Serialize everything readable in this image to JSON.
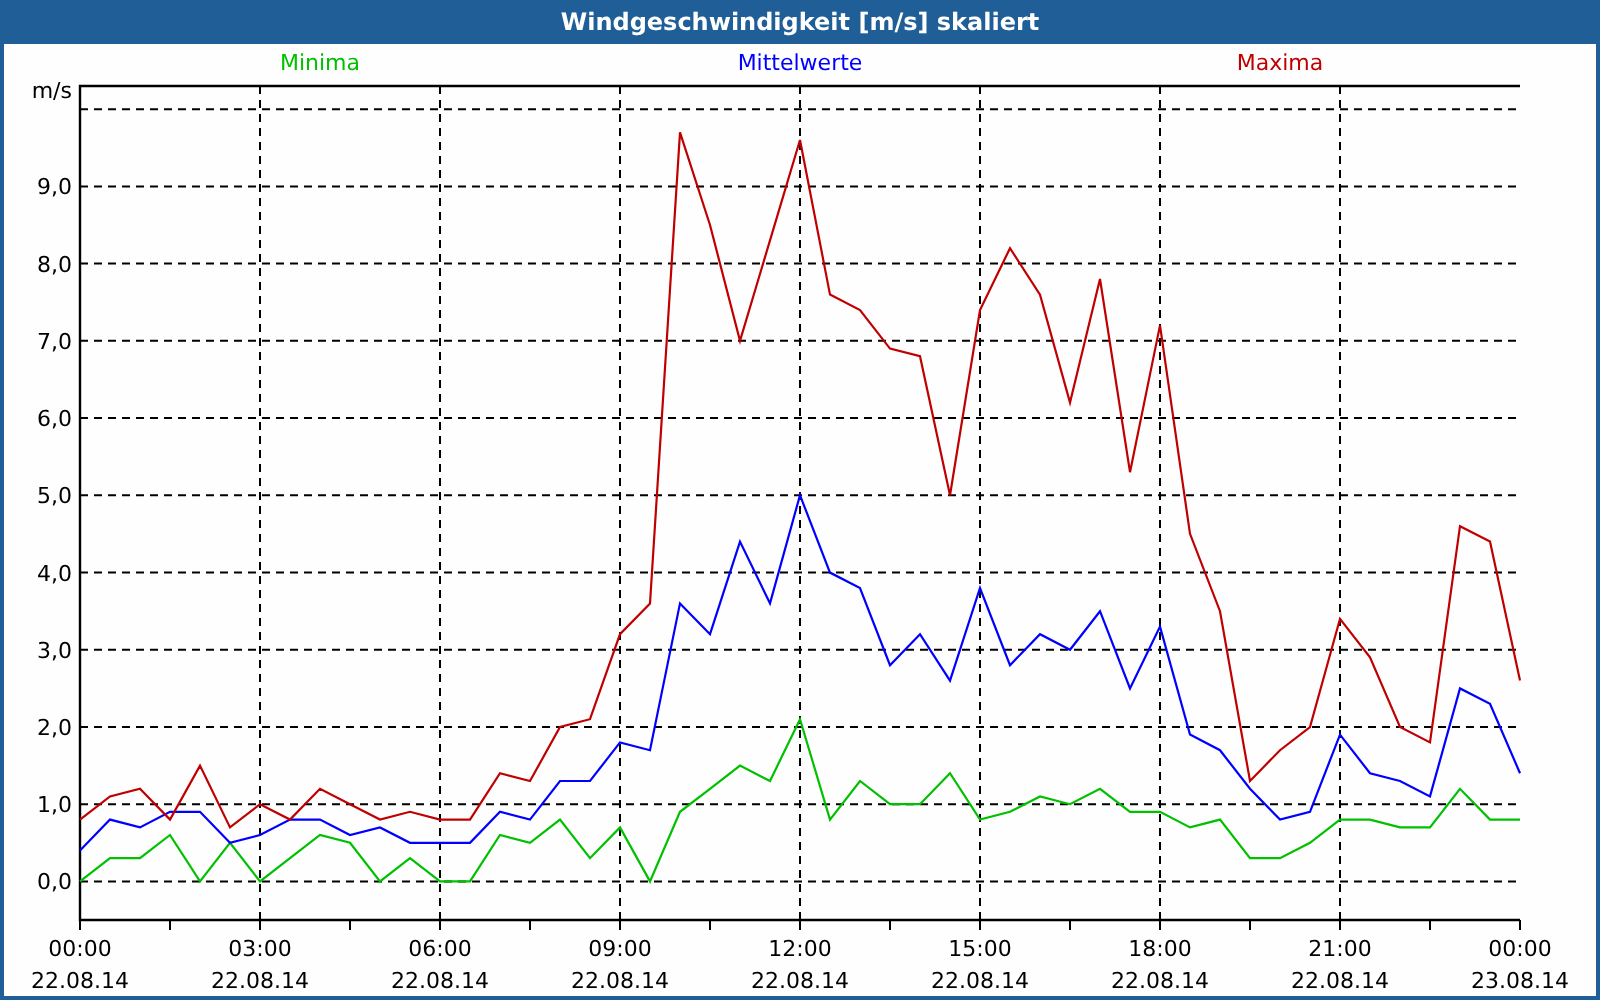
{
  "window": {
    "title": "Windgeschwindigkeit [m/s] skaliert"
  },
  "chart_data": {
    "type": "line",
    "grid": true,
    "ylabel": "m/s",
    "ylim": [
      -0.5,
      10.3
    ],
    "categories": [
      "00:00\n22.08.14",
      null,
      null,
      null,
      null,
      null,
      "03:00\n22.08.14",
      null,
      null,
      null,
      null,
      null,
      "06:00\n22.08.14",
      null,
      null,
      null,
      null,
      null,
      "09:00\n22.08.14",
      null,
      null,
      null,
      null,
      null,
      "12:00\n22.08.14",
      null,
      null,
      null,
      null,
      null,
      "15:00\n22.08.14",
      null,
      null,
      null,
      null,
      null,
      "18:00\n22.08.14",
      null,
      null,
      null,
      null,
      null,
      "21:00\n22.08.14",
      null,
      null,
      null,
      null,
      null,
      "00:00\n23.08.14"
    ],
    "yticks": [
      {
        "value": 0,
        "label": "0,0"
      },
      {
        "value": 1,
        "label": "1,0"
      },
      {
        "value": 2,
        "label": "2,0"
      },
      {
        "value": 3,
        "label": "3,0"
      },
      {
        "value": 4,
        "label": "4,0"
      },
      {
        "value": 5,
        "label": "5,0"
      },
      {
        "value": 6,
        "label": "6,0"
      },
      {
        "value": 7,
        "label": "7,0"
      },
      {
        "value": 8,
        "label": "8,0"
      },
      {
        "value": 9,
        "label": "9,0"
      }
    ],
    "series": [
      {
        "name": "Minima",
        "color": "#00c000",
        "values": [
          0.0,
          0.3,
          0.3,
          0.6,
          0.0,
          0.5,
          0.0,
          0.3,
          0.6,
          0.5,
          0.0,
          0.3,
          0.0,
          0.0,
          0.6,
          0.5,
          0.8,
          0.3,
          0.7,
          0.0,
          0.9,
          1.2,
          1.5,
          1.3,
          2.1,
          0.8,
          1.3,
          1.0,
          1.0,
          1.4,
          0.8,
          0.9,
          1.1,
          1.0,
          1.2,
          0.9,
          0.9,
          0.7,
          0.8,
          0.3,
          0.3,
          0.5,
          0.8,
          0.8,
          0.7,
          0.7,
          1.2,
          0.8,
          0.8
        ]
      },
      {
        "name": "Mittelwerte",
        "color": "#0000ff",
        "values": [
          0.4,
          0.8,
          0.7,
          0.9,
          0.9,
          0.5,
          0.6,
          0.8,
          0.8,
          0.6,
          0.7,
          0.5,
          0.5,
          0.5,
          0.9,
          0.8,
          1.3,
          1.3,
          1.8,
          1.7,
          3.6,
          3.2,
          4.4,
          3.6,
          5.0,
          4.0,
          3.8,
          2.8,
          3.2,
          2.6,
          3.8,
          2.8,
          3.2,
          3.0,
          3.5,
          2.5,
          3.3,
          1.9,
          1.7,
          1.2,
          0.8,
          0.9,
          1.9,
          1.4,
          1.3,
          1.1,
          2.5,
          2.3,
          1.4
        ]
      },
      {
        "name": "Maxima",
        "color": "#c00000",
        "values": [
          0.8,
          1.1,
          1.2,
          0.8,
          1.5,
          0.7,
          1.0,
          0.8,
          1.2,
          1.0,
          0.8,
          0.9,
          0.8,
          0.8,
          1.4,
          1.3,
          2.0,
          2.1,
          3.2,
          3.6,
          9.7,
          8.5,
          7.0,
          8.3,
          9.6,
          7.6,
          7.4,
          6.9,
          6.8,
          5.0,
          7.4,
          8.2,
          7.6,
          6.2,
          7.8,
          5.3,
          7.2,
          4.5,
          3.5,
          1.3,
          1.7,
          2.0,
          3.4,
          2.9,
          2.0,
          1.8,
          4.6,
          4.4,
          2.6
        ]
      }
    ]
  }
}
